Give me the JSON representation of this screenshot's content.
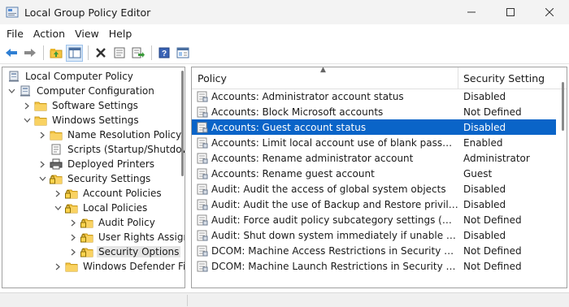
{
  "window": {
    "title": "Local Group Policy Editor"
  },
  "menu": [
    "File",
    "Action",
    "View",
    "Help"
  ],
  "toolbar": [
    "back-arrow-icon",
    "forward-arrow-icon",
    "up-folder-icon",
    "show-hide-tree-icon",
    "delete-icon",
    "properties-icon",
    "export-list-icon",
    "help-icon",
    "console-view-icon"
  ],
  "tree": [
    {
      "label": "Local Computer Policy",
      "icon": "computer-icon",
      "chev": "",
      "indent": 0
    },
    {
      "label": "Computer Configuration",
      "icon": "computer-icon",
      "chev": "⌄",
      "indent": 1
    },
    {
      "label": "Software Settings",
      "icon": "folder-icon",
      "chev": "›",
      "indent": 2
    },
    {
      "label": "Windows Settings",
      "icon": "folder-icon",
      "chev": "⌄",
      "indent": 2
    },
    {
      "label": "Name Resolution Policy",
      "icon": "folder-icon",
      "chev": "›",
      "indent": 3
    },
    {
      "label": "Scripts (Startup/Shutdow",
      "icon": "script-icon",
      "chev": "",
      "indent": 3
    },
    {
      "label": "Deployed Printers",
      "icon": "printer-icon",
      "chev": "›",
      "indent": 3
    },
    {
      "label": "Security Settings",
      "icon": "security-folder-icon",
      "chev": "⌄",
      "indent": 3
    },
    {
      "label": "Account Policies",
      "icon": "security-folder-icon",
      "chev": "›",
      "indent": 4
    },
    {
      "label": "Local Policies",
      "icon": "security-folder-icon",
      "chev": "⌄",
      "indent": 4
    },
    {
      "label": "Audit Policy",
      "icon": "security-folder-icon",
      "chev": "›",
      "indent": 5
    },
    {
      "label": "User Rights Assign",
      "icon": "security-folder-icon",
      "chev": "›",
      "indent": 5
    },
    {
      "label": "Security Options",
      "icon": "security-folder-icon",
      "chev": "›",
      "indent": 5,
      "selected": true
    },
    {
      "label": "Windows Defender Fi",
      "icon": "folder-icon",
      "chev": "›",
      "indent": 4
    }
  ],
  "list": {
    "col_policy": "Policy",
    "col_setting": "Security Setting",
    "rows": [
      {
        "policy": "Accounts: Administrator account status",
        "setting": "Disabled"
      },
      {
        "policy": "Accounts: Block Microsoft accounts",
        "setting": "Not Defined"
      },
      {
        "policy": "Accounts: Guest account status",
        "setting": "Disabled",
        "selected": true
      },
      {
        "policy": "Accounts: Limit local account use of blank passwords t...",
        "setting": "Enabled"
      },
      {
        "policy": "Accounts: Rename administrator account",
        "setting": "Administrator"
      },
      {
        "policy": "Accounts: Rename guest account",
        "setting": "Guest"
      },
      {
        "policy": "Audit: Audit the access of global system objects",
        "setting": "Disabled"
      },
      {
        "policy": "Audit: Audit the use of Backup and Restore privilege",
        "setting": "Disabled"
      },
      {
        "policy": "Audit: Force audit policy subcategory settings (Window...",
        "setting": "Not Defined"
      },
      {
        "policy": "Audit: Shut down system immediately if unable to log s...",
        "setting": "Disabled"
      },
      {
        "policy": "DCOM: Machine Access Restrictions in Security Descrip...",
        "setting": "Not Defined"
      },
      {
        "policy": "DCOM: Machine Launch Restrictions in Security Descrip...",
        "setting": "Not Defined"
      }
    ]
  },
  "colors": {
    "selection": "#0a64c8",
    "folder": "#f5c542"
  }
}
